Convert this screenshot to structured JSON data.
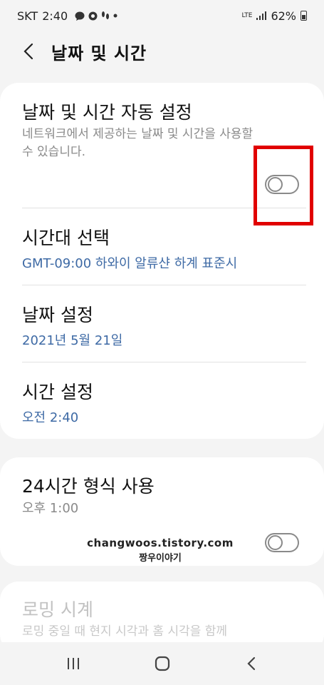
{
  "status_bar": {
    "carrier": "SKT",
    "time": "2:40",
    "notif_icons": [
      "talk-icon",
      "messenger-icon",
      "steps-icon",
      "dot-icon"
    ],
    "network": "LTE",
    "battery": "62%"
  },
  "header": {
    "title": "날짜 및 시간"
  },
  "settings": {
    "auto": {
      "title": "날짜 및 시간 자동 설정",
      "description": "네트워크에서 제공하는 날짜 및 시간을 사용할 수 있습니다.",
      "enabled": false
    },
    "timezone": {
      "title": "시간대 선택",
      "value": "GMT-09:00 하와이 알류샨 하계 표준시"
    },
    "date": {
      "title": "날짜 설정",
      "value": "2021년 5월 21일"
    },
    "time": {
      "title": "시간 설정",
      "value": "오전 2:40"
    },
    "format24": {
      "title": "24시간 형식 사용",
      "value": "오후 1:00",
      "enabled": false
    },
    "roaming": {
      "title": "로밍 시계",
      "description": "로밍 중일 때 현지 시각과 홈 시각을 함께"
    }
  },
  "watermark": {
    "line1": "changwoos.tistory.com",
    "line2": "짱우이야기"
  },
  "colors": {
    "accent_value": "#3e6aa5",
    "highlight": "#e10000",
    "background": "#f4f4f4"
  },
  "nav": {
    "buttons": [
      "recents-icon",
      "home-icon",
      "back-icon"
    ]
  }
}
